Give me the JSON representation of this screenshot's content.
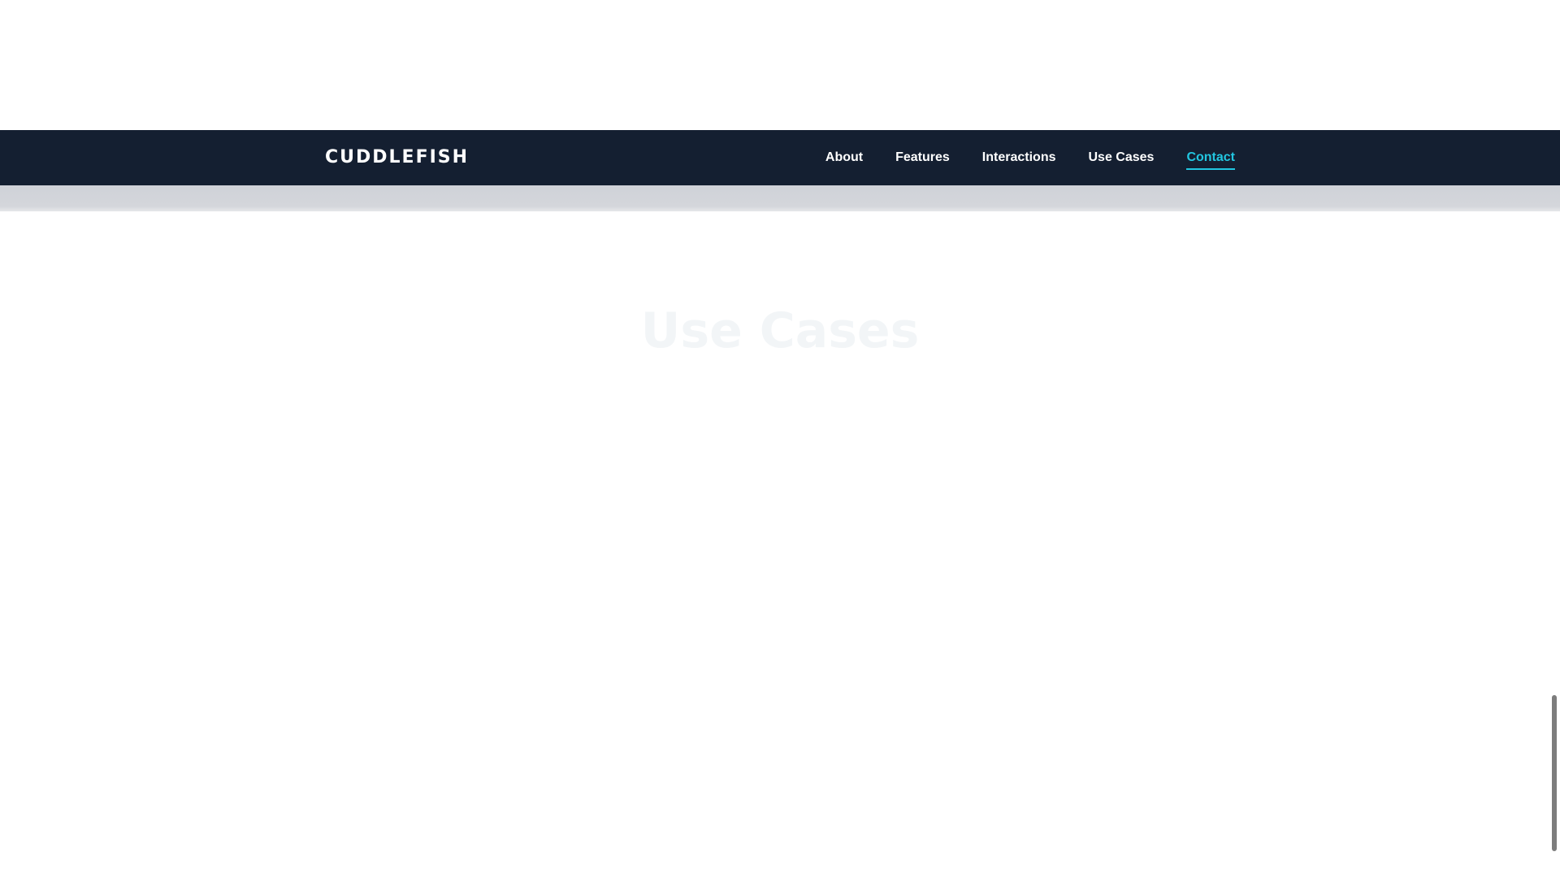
{
  "header": {
    "brand": "CUDDLEFISH",
    "nav": [
      {
        "label": "About",
        "active": false
      },
      {
        "label": "Features",
        "active": false
      },
      {
        "label": "Interactions",
        "active": false
      },
      {
        "label": "Use Cases",
        "active": false
      },
      {
        "label": "Contact",
        "active": true
      }
    ]
  },
  "section": {
    "title": "Use Cases"
  },
  "colors": {
    "navbar_bg": "#141f31",
    "accent": "#22c6e0",
    "nav_text": "#ffffff"
  }
}
